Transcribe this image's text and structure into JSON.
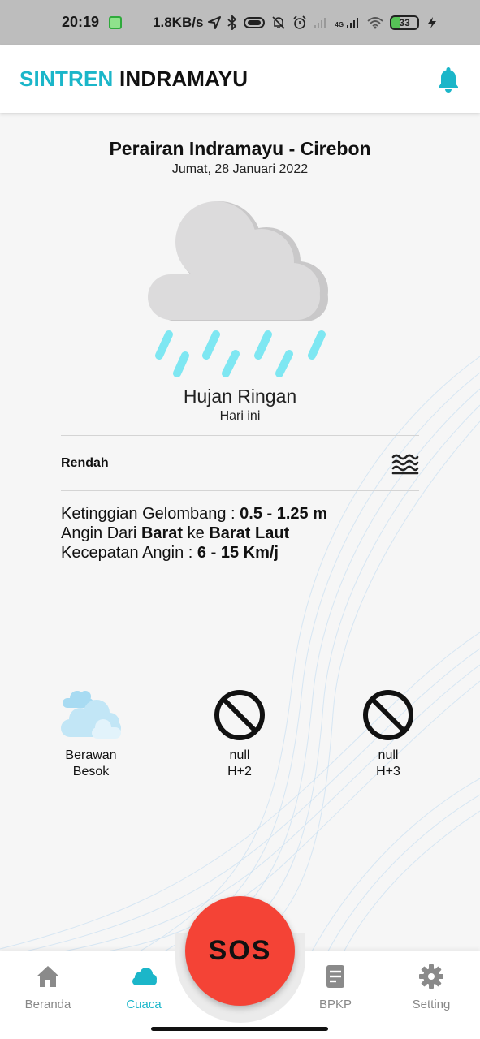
{
  "status_bar": {
    "time": "20:19",
    "network_speed": "1.8KB/s",
    "battery_level": "33",
    "icons": [
      "app-notification-icon",
      "location-arrow-icon",
      "bluetooth-icon",
      "nfc-icon",
      "silent-bell-icon",
      "alarm-icon",
      "signal-icon",
      "4g-signal-icon",
      "wifi-icon",
      "battery-icon",
      "charging-icon"
    ],
    "network_label": "4G"
  },
  "app_bar": {
    "title_part1": "SINTREN",
    "title_part2": "INDRAMAYU",
    "notification_icon": "bell-icon"
  },
  "weather": {
    "location": "Perairan Indramayu - Cirebon",
    "date": "Jumat, 28 Januari 2022",
    "condition": "Hujan Ringan",
    "period": "Hari ini",
    "icon": "rain-cloud-icon"
  },
  "wave": {
    "level": "Rendah",
    "icon": "waves-icon"
  },
  "details": {
    "wave_height_label": "Ketinggian Gelombang : ",
    "wave_height_value": "0.5 - 1.25 m",
    "wind_from_label": "Angin Dari ",
    "wind_from": "Barat",
    "wind_to_label": " ke ",
    "wind_to": "Barat Laut",
    "wind_speed_label": "Kecepatan Angin : ",
    "wind_speed_value": "6 - 15 Km/j"
  },
  "forecast": [
    {
      "condition": "Berawan",
      "day": "Besok",
      "icon": "cloudy-icon"
    },
    {
      "condition": "null",
      "day": "H+2",
      "icon": "no-symbol-icon"
    },
    {
      "condition": "null",
      "day": "H+3",
      "icon": "no-symbol-icon"
    }
  ],
  "bottom_nav": {
    "items": [
      {
        "label": "Beranda",
        "icon": "home-icon"
      },
      {
        "label": "Cuaca",
        "icon": "cloud-icon"
      },
      {
        "label": "BPKP",
        "icon": "document-icon"
      },
      {
        "label": "Setting",
        "icon": "gear-icon"
      }
    ],
    "sos_label": "SOS",
    "active": "Cuaca"
  },
  "colors": {
    "accent": "#1bb6c9",
    "sos": "#f44336",
    "rain": "#7ee7f2",
    "cloud": "#dcdbdc"
  }
}
